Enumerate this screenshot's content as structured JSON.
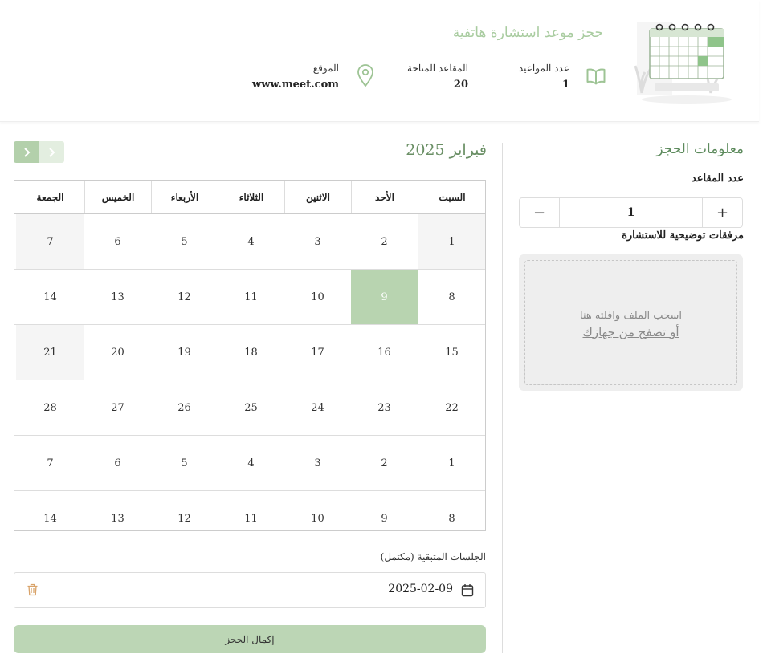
{
  "header": {
    "title": "حجز موعد استشارة هاتفية",
    "stats": {
      "appointments": {
        "label": "عدد المواعيد",
        "value": "1"
      },
      "seats": {
        "label": "المقاعد المتاحة",
        "value": "20"
      },
      "location": {
        "label": "الموقع",
        "value": "www.meet.com"
      }
    },
    "icons": [
      "calendar-illustration",
      "book-icon",
      "map-pin-icon"
    ]
  },
  "booking": {
    "heading": "معلومات الحجز",
    "seats_label": "عدد المقاعد",
    "seats_value": "1",
    "increment_label": "+",
    "decrement_label": "−",
    "attachments_label": "مرفقات توضيحية للاستشارة",
    "drop_hint": "اسحب الملف وافلته هنا",
    "browse_link": "أو تصفح من جهازك"
  },
  "calendar": {
    "month_title": "فبراير 2025",
    "weekdays": [
      "السبت",
      "الأحد",
      "الاثنين",
      "الثلاثاء",
      "الأربعاء",
      "الخميس",
      "الجمعة"
    ],
    "weeks": [
      [
        "1",
        "2",
        "3",
        "4",
        "5",
        "6",
        "7"
      ],
      [
        "8",
        "9",
        "10",
        "11",
        "12",
        "13",
        "14"
      ],
      [
        "15",
        "16",
        "17",
        "18",
        "19",
        "20",
        "21"
      ],
      [
        "22",
        "23",
        "24",
        "25",
        "26",
        "27",
        "28"
      ],
      [
        "1",
        "2",
        "3",
        "4",
        "5",
        "6",
        "7"
      ],
      [
        "8",
        "9",
        "10",
        "11",
        "12",
        "13",
        "14"
      ]
    ],
    "selected_day": "9",
    "nav_icons": [
      "chevron-left-icon",
      "chevron-right-icon"
    ]
  },
  "sessions": {
    "label": "الجلسات المتبقية (مكتمل)",
    "items": [
      {
        "date": "2025-02-09"
      }
    ]
  },
  "submit_label": "إكمال الحجز",
  "colors": {
    "accent": "#b8d4b0",
    "accent_text": "#5c8a5c",
    "title_green": "#a9cca0",
    "delete": "#d9a36a"
  }
}
